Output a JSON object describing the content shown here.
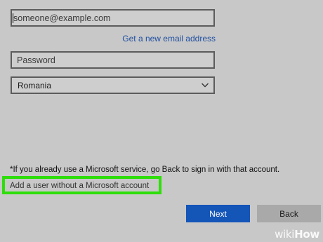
{
  "form": {
    "email_placeholder": "someone@example.com",
    "new_email_link": "Get a new email address",
    "password_placeholder": "Password",
    "country_value": "Romania"
  },
  "note": "*If you already use a Microsoft service, go Back to sign in with that account.",
  "no_account_link": "Add a user without a Microsoft account",
  "buttons": {
    "next": "Next",
    "back": "Back"
  },
  "watermark": {
    "part1": "wiki",
    "part2": "How"
  },
  "colors": {
    "background": "#c8c8c8",
    "next_button": "#1455b8",
    "back_button": "#a9a9a9",
    "highlight": "#2dde0a",
    "link": "#1f4fa1"
  },
  "icons": [
    "chevron-down-icon"
  ]
}
